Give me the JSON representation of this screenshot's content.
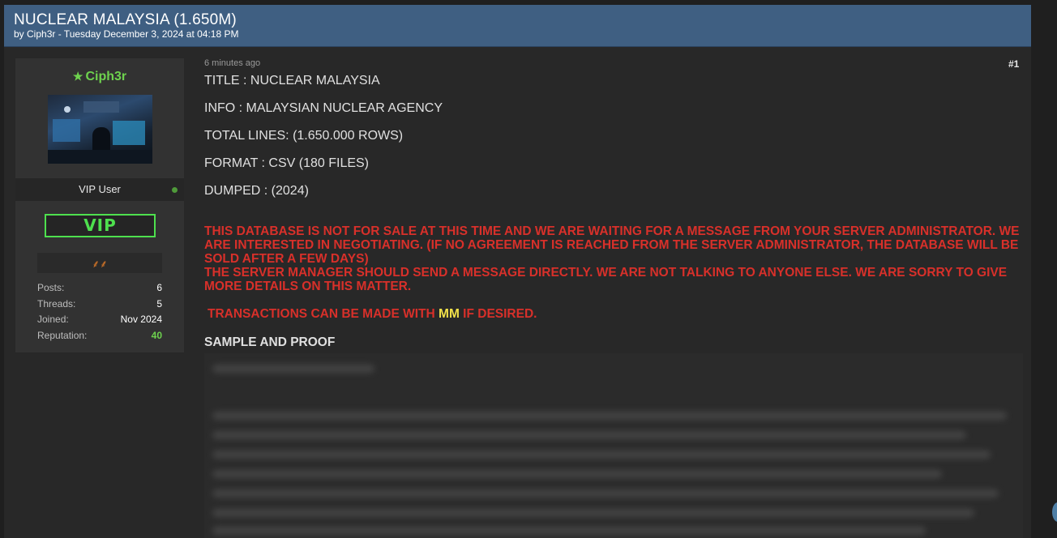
{
  "thread": {
    "title": "NUCLEAR MALAYSIA (1.650M)",
    "meta": "by Ciph3r - Tuesday December 3, 2024 at 04:18 PM"
  },
  "user": {
    "name": "Ciph3r",
    "title": "VIP User",
    "badge": "VIP",
    "stats": [
      {
        "label": "Posts:",
        "value": "6"
      },
      {
        "label": "Threads:",
        "value": "5"
      },
      {
        "label": "Joined:",
        "value": "Nov 2024"
      },
      {
        "label": "Reputation:",
        "value": "40"
      }
    ]
  },
  "post": {
    "time": "6 minutes ago",
    "number": "#1",
    "fields": [
      "TITLE : NUCLEAR MALAYSIA",
      "INFO :  MALAYSIAN NUCLEAR AGENCY",
      "TOTAL LINES: (1.650.000 ROWS)",
      "FORMAT :  CSV (180 FILES)",
      "DUMPED :  (2024)"
    ],
    "warning_1": "THIS DATABASE IS NOT FOR SALE AT THIS TIME AND WE ARE WAITING FOR A MESSAGE FROM YOUR SERVER ADMINISTRATOR. WE ARE INTERESTED IN NEGOTIATING. (IF NO AGREEMENT IS REACHED FROM THE SERVER ADMINISTRATOR, THE DATABASE WILL BE SOLD AFTER A FEW DAYS)",
    "warning_2": "THE SERVER MANAGER SHOULD SEND A MESSAGE DIRECTLY. WE ARE NOT TALKING TO ANYONE ELSE. WE ARE SORRY TO GIVE MORE DETAILS ON THIS MATTER.",
    "transactions_pre": "TRANSACTIONS CAN BE MADE WITH ",
    "transactions_mm": "MM",
    "transactions_post": " IF DESIRED.",
    "sample_title": "SAMPLE AND PROOF"
  },
  "colors": {
    "header": "#3f5f82",
    "username": "#6ed24e",
    "warning": "#d8302a",
    "mm": "#f2e14a",
    "vip": "#4ee04e"
  },
  "icons": {
    "star": "star-icon",
    "award": "award-icon",
    "online": "online-dot-icon"
  }
}
